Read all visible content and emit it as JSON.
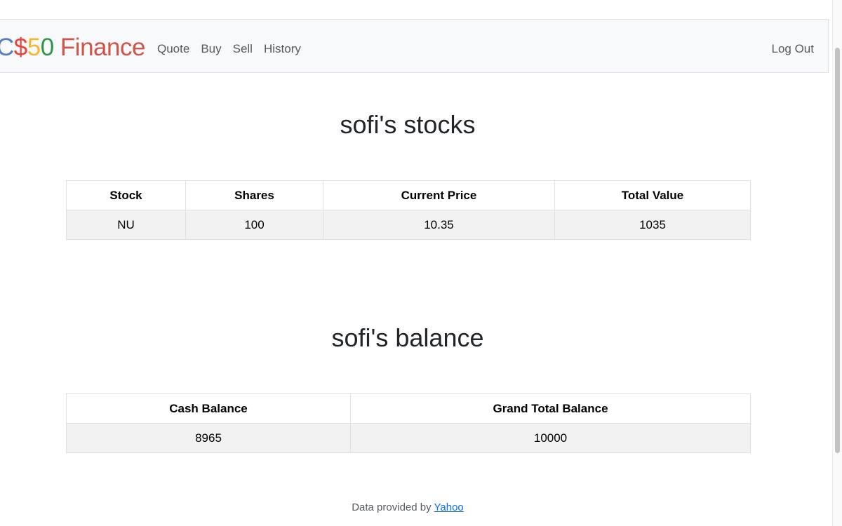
{
  "navbar": {
    "brand": {
      "c": "C",
      "dollar": "$",
      "five": "5",
      "zero": "0",
      "finance": " Finance"
    },
    "links": [
      "Quote",
      "Buy",
      "Sell",
      "History"
    ],
    "logout": "Log Out"
  },
  "stocks": {
    "title": "sofi's stocks",
    "headers": [
      "Stock",
      "Shares",
      "Current Price",
      "Total Value"
    ],
    "rows": [
      [
        "NU",
        "100",
        "10.35",
        "1035"
      ]
    ]
  },
  "balance": {
    "title": "sofi's balance",
    "headers": [
      "Cash Balance",
      "Grand Total Balance"
    ],
    "rows": [
      [
        "8965",
        "10000"
      ]
    ]
  },
  "footer": {
    "text": "Data provided by ",
    "link": "Yahoo"
  }
}
